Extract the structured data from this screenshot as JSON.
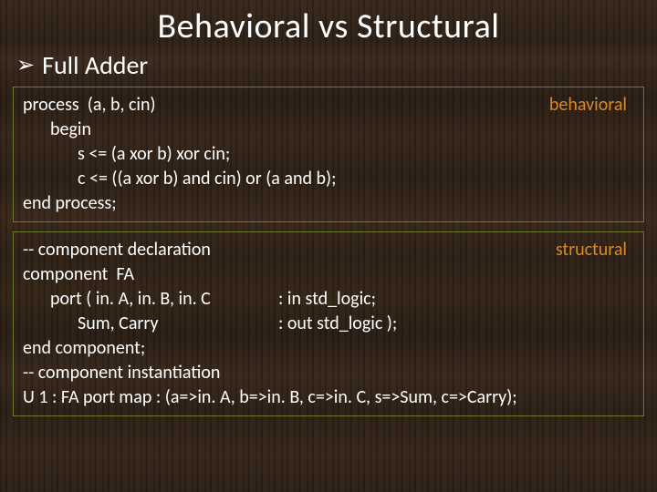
{
  "title": "Behavioral vs Structural",
  "bullet_glyph": "➢",
  "subtitle": "Full Adder",
  "behavioral": {
    "badge": "behavioral",
    "l1": "process  (a, b, cin)",
    "l2": "begin",
    "l3": "s <= (a xor b) xor cin;",
    "l4": "c <= ((a xor b) and cin) or (a and b);",
    "l5": "end process;"
  },
  "structural": {
    "badge": "structural",
    "l1": "-- component declaration",
    "l2": "component  FA",
    "p1_left": "port ( in. A, in. B, in. C",
    "p1_right": ": in std_logic;",
    "p2_left": "Sum, Carry",
    "p2_right": ": out std_logic );",
    "l5": "end component;",
    "l6": "-- component instantiation",
    "l7": "U 1 : FA port map : (a=>in. A, b=>in. B, c=>in. C, s=>Sum, c=>Carry);"
  }
}
